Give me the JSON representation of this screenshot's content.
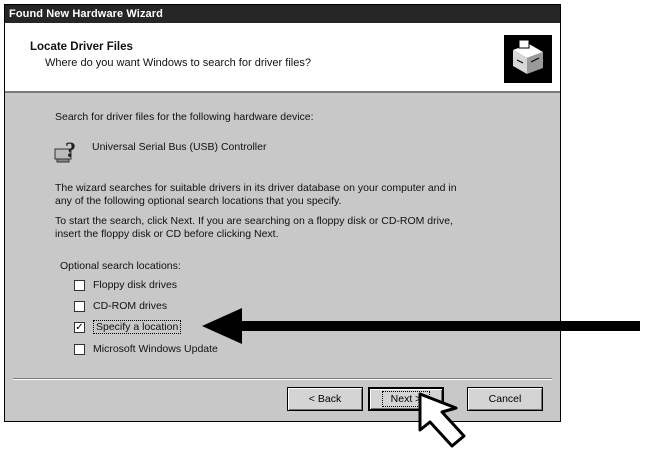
{
  "window": {
    "title": "Found New Hardware Wizard"
  },
  "header": {
    "title": "Locate Driver Files",
    "subtitle": "Where do you want Windows to search for driver files?",
    "icon": "hardware-wizard-icon"
  },
  "content": {
    "intro": "Search for driver files for the following hardware device:",
    "device_name": "Universal Serial Bus (USB) Controller",
    "device_icon": "unknown-device-question-icon",
    "paragraph1_line1": "The wizard searches for suitable drivers in its driver database on your computer and in",
    "paragraph1_line2": "any of the following optional search locations that you specify.",
    "paragraph2_line1": "To start the search, click Next. If you are searching on a floppy disk or CD-ROM drive,",
    "paragraph2_line2": "insert the floppy disk or CD before clicking Next."
  },
  "options": {
    "title": "Optional search locations:",
    "items": [
      {
        "label": "Floppy disk drives",
        "checked": false
      },
      {
        "label": "CD-ROM drives",
        "checked": false
      },
      {
        "label": "Specify a location",
        "checked": true
      },
      {
        "label": "Microsoft Windows Update",
        "checked": false
      }
    ]
  },
  "buttons": {
    "back": "< Back",
    "next": "Next >",
    "cancel": "Cancel"
  },
  "annotations": {
    "arrow": "arrow-pointer-icon",
    "cursor": "hand-cursor-icon"
  }
}
